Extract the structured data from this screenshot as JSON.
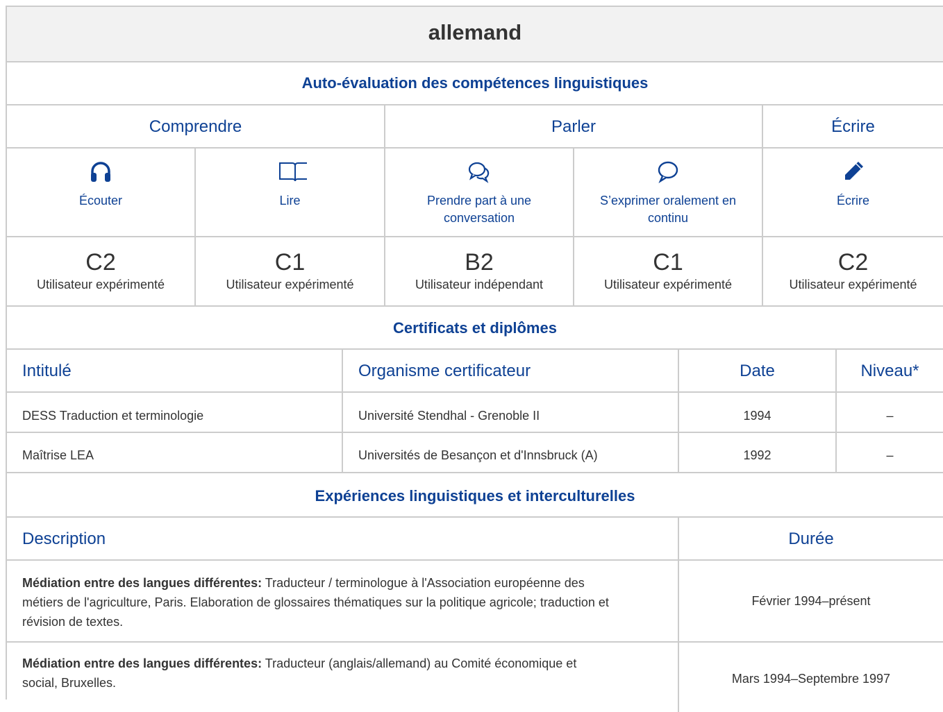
{
  "language": "allemand",
  "self_assessment": {
    "heading": "Auto-évaluation des compétences linguistiques",
    "groups": [
      "Comprendre",
      "Parler",
      "Écrire"
    ],
    "skills": [
      {
        "label": "Écouter",
        "icon": "headphones-icon",
        "code": "C2",
        "level": "Utilisateur expérimenté"
      },
      {
        "label": "Lire",
        "icon": "book-icon",
        "code": "C1",
        "level": "Utilisateur expérimenté"
      },
      {
        "label_line1": "Prendre part à une",
        "label_line2": "conversation",
        "icon": "conversation-icon",
        "code": "B2",
        "level": "Utilisateur indépendant"
      },
      {
        "label_line1": "S’exprimer oralement en",
        "label_line2": "continu",
        "icon": "speech-bubble-icon",
        "code": "C1",
        "level": "Utilisateur expérimenté"
      },
      {
        "label": "Écrire",
        "icon": "pencil-icon",
        "code": "C2",
        "level": "Utilisateur expérimenté"
      }
    ]
  },
  "certificates": {
    "heading": "Certificats et diplômes",
    "columns": [
      "Intitulé",
      "Organisme certificateur",
      "Date",
      "Niveau*"
    ],
    "rows": [
      {
        "title": "DESS Traduction et terminologie",
        "org": "Université Stendhal - Grenoble II",
        "date": "1994",
        "level": "–"
      },
      {
        "title": "Maîtrise LEA",
        "org": "Universités de Besançon et d'Innsbruck (A)",
        "date": "1992",
        "level": "–"
      }
    ]
  },
  "experiences": {
    "heading": "Expériences linguistiques et interculturelles",
    "columns": [
      "Description",
      "Durée"
    ],
    "rows": [
      {
        "bold": "Médiation entre des langues différentes:",
        "line1": " Traducteur / terminologue à l'Association européenne des",
        "line2": "métiers de l'agriculture, Paris. Elaboration de glossaires thématiques sur la politique agricole; traduction et",
        "line3": "révision de textes.",
        "duration": "Février 1994–présent"
      },
      {
        "bold": "Médiation entre des langues différentes:",
        "line1": " Traducteur (anglais/allemand) au Comité économique et",
        "line2": "social, Bruxelles.",
        "duration": "Mars 1994–Septembre 1997"
      }
    ]
  },
  "colors": {
    "accent": "#0e4194",
    "border": "#cccccc",
    "header_bg": "#f2f2f2",
    "text": "#333333"
  }
}
